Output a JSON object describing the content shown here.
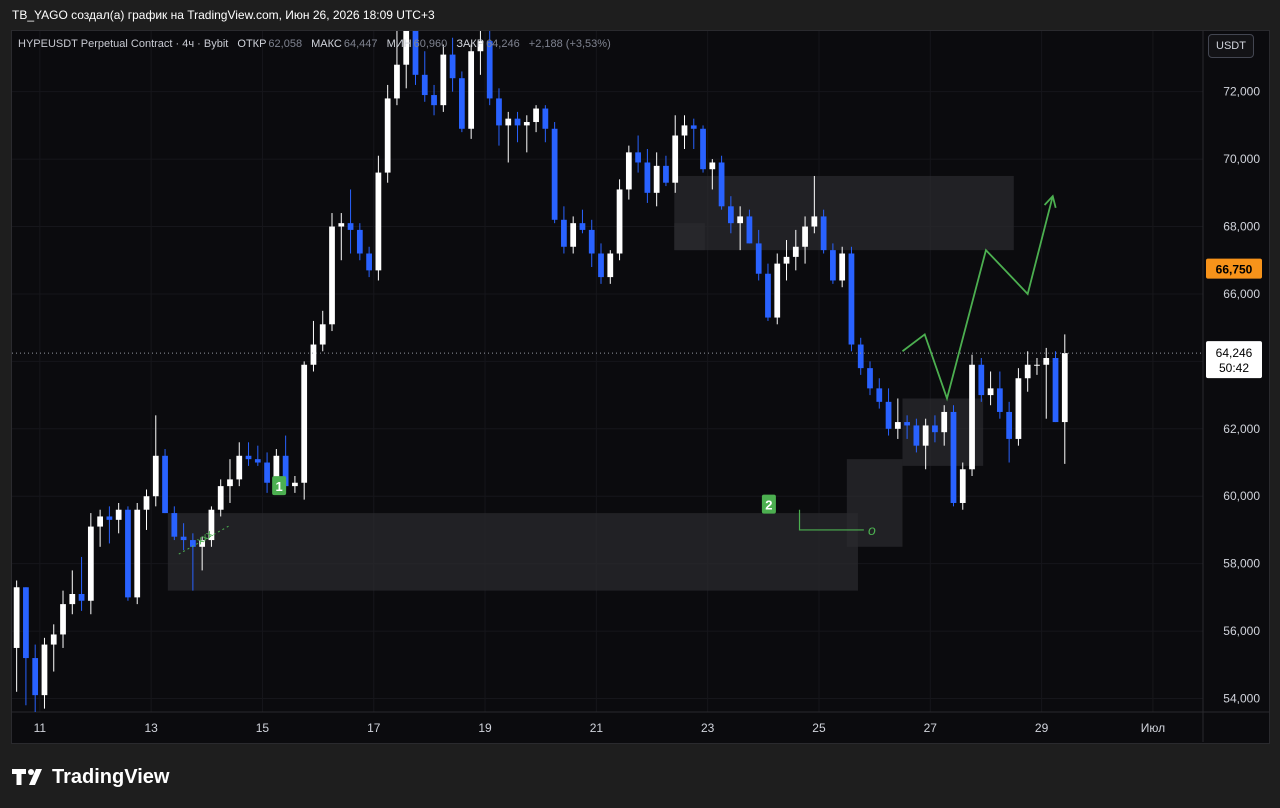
{
  "header": {
    "caption": "TB_YAGO создал(а) график на TradingView.com, Июн 26, 2026 18:09 UTC+3"
  },
  "legend": {
    "symbol": "HYPEUSDT Perpetual Contract · 4ч · Bybit",
    "open_label": "ОТКР",
    "open_value": "62,058",
    "high_label": "МАКС",
    "high_value": "64,447",
    "low_label": "МИН",
    "low_value": "60,960",
    "close_label": "ЗАКР",
    "close_value": "64,246",
    "change": "+2,188 (+3,53%)"
  },
  "currency_button": "USDT",
  "footer": {
    "brand": "TradingView"
  },
  "colors": {
    "up": "#ffffff",
    "down": "#2962ff",
    "zone": "#2a2a2e",
    "annotation": "#4caf50",
    "price_tag": "#f7931a"
  },
  "chart_data": {
    "type": "candlestick",
    "title": "",
    "y_axis_ticks": [
      "54,000",
      "56,000",
      "58,000",
      "60,000",
      "62,000",
      "64,000",
      "66,000",
      "68,000",
      "70,000",
      "72,000"
    ],
    "y_tick_values": [
      54000,
      56000,
      58000,
      60000,
      62000,
      64000,
      66000,
      68000,
      70000,
      72000
    ],
    "x_axis_ticks": [
      "11",
      "13",
      "15",
      "17",
      "19",
      "21",
      "23",
      "25",
      "27",
      "29",
      "Июл"
    ],
    "x_tick_days": [
      11,
      13,
      15,
      17,
      19,
      21,
      23,
      25,
      27,
      29,
      31
    ],
    "ylim": [
      53600,
      73800
    ],
    "xlim": [
      10.5,
      31.9
    ],
    "current_price": {
      "value": 64246,
      "label": "64,246",
      "countdown": "50:42"
    },
    "alert_price": {
      "value": 66750,
      "label": "66,750"
    },
    "candles_start_day": 10.5,
    "candles_per_day": 6,
    "candles": [
      [
        55500,
        57500,
        54200,
        57300
      ],
      [
        57300,
        57300,
        53800,
        55200
      ],
      [
        55200,
        55600,
        53600,
        54100
      ],
      [
        54100,
        55800,
        53700,
        55600
      ],
      [
        55600,
        56200,
        54800,
        55900
      ],
      [
        55900,
        57200,
        55500,
        56800
      ],
      [
        56800,
        57800,
        56500,
        57100
      ],
      [
        57100,
        58200,
        56600,
        56900
      ],
      [
        56900,
        59500,
        56500,
        59100
      ],
      [
        59100,
        59600,
        58500,
        59400
      ],
      [
        59400,
        59700,
        58600,
        59300
      ],
      [
        59300,
        59800,
        58900,
        59600
      ],
      [
        59600,
        59700,
        56900,
        57000
      ],
      [
        57000,
        59800,
        56800,
        59600
      ],
      [
        59600,
        60200,
        59000,
        60000
      ],
      [
        60000,
        62400,
        59700,
        61200
      ],
      [
        61200,
        61400,
        59500,
        59500
      ],
      [
        59500,
        59700,
        58700,
        58800
      ],
      [
        58800,
        59200,
        58400,
        58700
      ],
      [
        58700,
        58900,
        57200,
        58500
      ],
      [
        58500,
        58800,
        57800,
        58700
      ],
      [
        58700,
        59700,
        58500,
        59600
      ],
      [
        59600,
        60500,
        59400,
        60300
      ],
      [
        60300,
        61100,
        59800,
        60500
      ],
      [
        60500,
        61600,
        60300,
        61200
      ],
      [
        61200,
        61600,
        60900,
        61100
      ],
      [
        61100,
        61500,
        60900,
        61000
      ],
      [
        61000,
        61300,
        60100,
        60400
      ],
      [
        60400,
        61400,
        60200,
        61200
      ],
      [
        61200,
        61800,
        60300,
        60300
      ],
      [
        60300,
        60600,
        60100,
        60400
      ],
      [
        60400,
        64000,
        59900,
        63900
      ],
      [
        63900,
        65200,
        63700,
        64500
      ],
      [
        64500,
        65500,
        64300,
        65100
      ],
      [
        65100,
        68400,
        64900,
        68000
      ],
      [
        68000,
        68400,
        67000,
        68100
      ],
      [
        68100,
        69100,
        67200,
        67900
      ],
      [
        67900,
        68100,
        67000,
        67200
      ],
      [
        67200,
        67400,
        66500,
        66700
      ],
      [
        66700,
        70100,
        66400,
        69600
      ],
      [
        69600,
        72200,
        69300,
        71800
      ],
      [
        71800,
        73800,
        71600,
        72800
      ],
      [
        72800,
        73800,
        72100,
        73800
      ],
      [
        73800,
        73800,
        72200,
        72500
      ],
      [
        72500,
        73200,
        71700,
        71900
      ],
      [
        71900,
        72200,
        71300,
        71600
      ],
      [
        71600,
        73400,
        71400,
        73100
      ],
      [
        73100,
        73600,
        72000,
        72400
      ],
      [
        72400,
        72600,
        70800,
        70900
      ],
      [
        70900,
        73400,
        70600,
        73200
      ],
      [
        73200,
        73800,
        72500,
        73500
      ],
      [
        73500,
        73800,
        71600,
        71800
      ],
      [
        71800,
        72100,
        70400,
        71000
      ],
      [
        71000,
        71400,
        69900,
        71200
      ],
      [
        71200,
        71400,
        70500,
        71000
      ],
      [
        71000,
        71300,
        70200,
        71100
      ],
      [
        71100,
        71600,
        70800,
        71500
      ],
      [
        71500,
        71600,
        70500,
        70900
      ],
      [
        70900,
        71100,
        68100,
        68200
      ],
      [
        68200,
        68600,
        67200,
        67400
      ],
      [
        67400,
        68300,
        67200,
        68100
      ],
      [
        68100,
        68500,
        67800,
        67900
      ],
      [
        67900,
        68200,
        66800,
        67200
      ],
      [
        67200,
        67500,
        66300,
        66500
      ],
      [
        66500,
        67300,
        66300,
        67200
      ],
      [
        67200,
        69400,
        67000,
        69100
      ],
      [
        69100,
        70400,
        68800,
        70200
      ],
      [
        70200,
        70700,
        69600,
        69900
      ],
      [
        69900,
        70300,
        68700,
        69000
      ],
      [
        69000,
        70200,
        68600,
        69800
      ],
      [
        69800,
        70100,
        69200,
        69300
      ],
      [
        69300,
        71300,
        69000,
        70700
      ],
      [
        70700,
        71300,
        70300,
        71000
      ],
      [
        71000,
        71200,
        70300,
        70900
      ],
      [
        70900,
        71000,
        69600,
        69700
      ],
      [
        69700,
        70000,
        69100,
        69900
      ],
      [
        69900,
        70100,
        68500,
        68600
      ],
      [
        68600,
        68900,
        67800,
        68100
      ],
      [
        68100,
        68600,
        67300,
        68300
      ],
      [
        68300,
        68500,
        67500,
        67500
      ],
      [
        67500,
        67900,
        66400,
        66600
      ],
      [
        66600,
        66900,
        65200,
        65300
      ],
      [
        65300,
        67200,
        65100,
        66900
      ],
      [
        66900,
        67600,
        66400,
        67100
      ],
      [
        67100,
        67900,
        66700,
        67400
      ],
      [
        67400,
        68300,
        66900,
        68000
      ],
      [
        68000,
        69500,
        67800,
        68300
      ],
      [
        68300,
        68500,
        67200,
        67300
      ],
      [
        67300,
        67500,
        66300,
        66400
      ],
      [
        66400,
        67400,
        66200,
        67200
      ],
      [
        67200,
        67400,
        64300,
        64500
      ],
      [
        64500,
        64700,
        63600,
        63800
      ],
      [
        63800,
        64000,
        63000,
        63200
      ],
      [
        63200,
        63500,
        62600,
        62800
      ],
      [
        62800,
        63200,
        61800,
        62000
      ],
      [
        62000,
        62900,
        61700,
        62200
      ],
      [
        62200,
        62400,
        61700,
        62100
      ],
      [
        62100,
        62300,
        61300,
        61500
      ],
      [
        61500,
        62300,
        60800,
        62100
      ],
      [
        62100,
        62400,
        61600,
        61900
      ],
      [
        61900,
        62700,
        61500,
        62500
      ],
      [
        62500,
        62700,
        59700,
        59800
      ],
      [
        59800,
        61000,
        59600,
        60800
      ],
      [
        60800,
        64200,
        60600,
        63900
      ],
      [
        63900,
        64100,
        62800,
        63000
      ],
      [
        63000,
        63700,
        62700,
        63200
      ],
      [
        63200,
        63700,
        62300,
        62500
      ],
      [
        62500,
        62800,
        61000,
        61700
      ],
      [
        61700,
        63800,
        61500,
        63500
      ],
      [
        63500,
        64300,
        63100,
        63900
      ],
      [
        63900,
        64100,
        63600,
        63900
      ],
      [
        63900,
        64400,
        62300,
        64100
      ],
      [
        64100,
        64300,
        62200,
        62200
      ],
      [
        62200,
        64800,
        60960,
        64246
      ]
    ],
    "zones": [
      {
        "day_from": 13.3,
        "day_to": 25.7,
        "price_from": 57200,
        "price_to": 59500
      },
      {
        "day_from": 22.4,
        "day_to": 28.5,
        "price_from": 67300,
        "price_to": 69500
      },
      {
        "day_from": 22.4,
        "day_to": 22.95,
        "price_from": 67300,
        "price_to": 68100
      },
      {
        "day_from": 25.5,
        "day_to": 26.5,
        "price_from": 58500,
        "price_to": 61100
      },
      {
        "day_from": 26.5,
        "day_to": 27.95,
        "price_from": 60900,
        "price_to": 62900
      }
    ],
    "annotations": [
      {
        "text": "1",
        "day": 15.3,
        "price": 60300
      },
      {
        "text": "2",
        "day": 24.1,
        "price": 59750
      },
      {
        "text": "xxx",
        "day": 14.0,
        "price": 58700
      },
      {
        "text": "o",
        "day": 25.95,
        "price": 59000
      }
    ],
    "projection_path": [
      [
        26.5,
        64300
      ],
      [
        26.9,
        64800
      ],
      [
        27.3,
        62900
      ],
      [
        28.0,
        67300
      ],
      [
        28.75,
        66000
      ],
      [
        29.2,
        68900
      ]
    ]
  }
}
